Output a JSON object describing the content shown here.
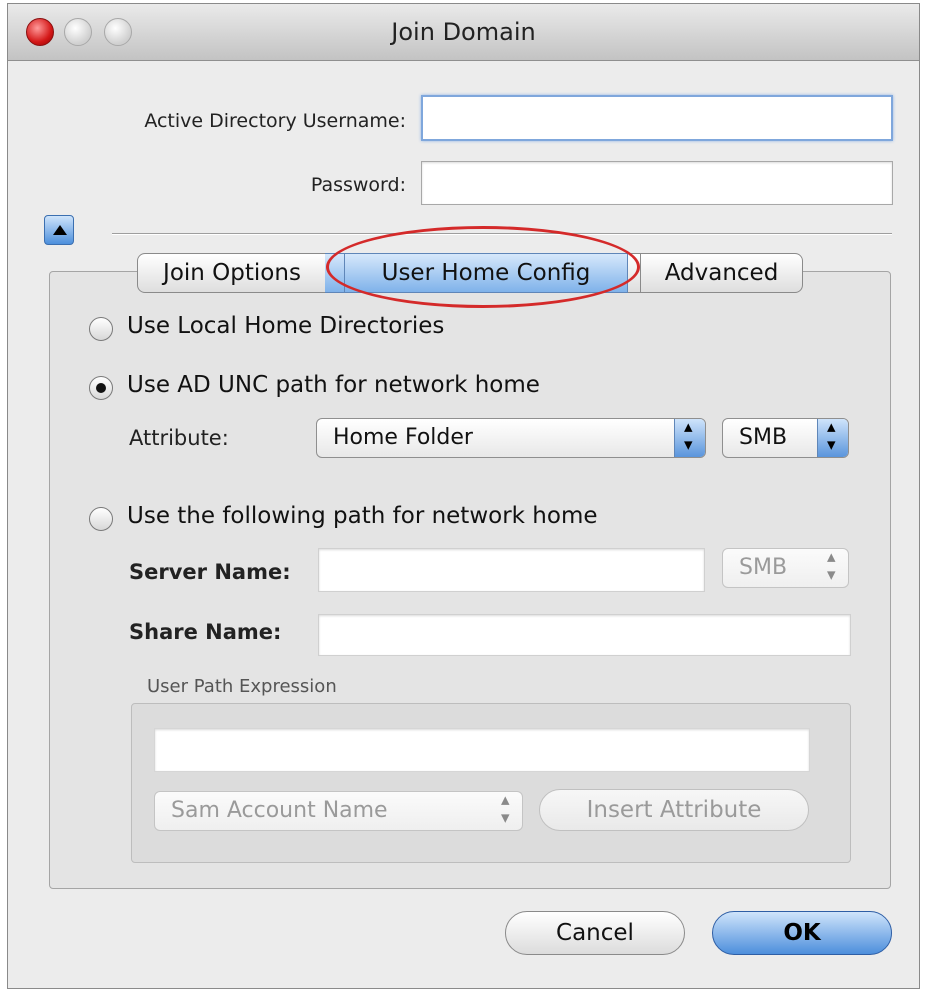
{
  "window": {
    "title": "Join Domain"
  },
  "credentials": {
    "username_label": "Active Directory Username:",
    "username_value": "",
    "password_label": "Password:",
    "password_value": ""
  },
  "tabs": {
    "join_options": "Join Options",
    "user_home_config": "User Home Config",
    "advanced": "Advanced",
    "selected": "User Home Config"
  },
  "home_config": {
    "option_local": "Use Local Home Directories",
    "option_ad_unc": "Use AD UNC path for network home",
    "option_custom_path": "Use the following path for network home",
    "selected_option": "Use AD UNC path for network home",
    "attribute_label": "Attribute:",
    "attribute_value": "Home Folder",
    "protocol_value": "SMB",
    "server_name_label": "Server Name:",
    "server_name_value": "",
    "server_protocol_value": "SMB",
    "share_name_label": "Share Name:",
    "share_name_value": ""
  },
  "user_path": {
    "group_label": "User Path Expression",
    "expression_value": "",
    "attribute_select": "Sam Account Name",
    "insert_button": "Insert Attribute"
  },
  "footer": {
    "cancel": "Cancel",
    "ok": "OK"
  },
  "colors": {
    "accent": "#4d8fdc",
    "highlight": "#d42a2a"
  }
}
